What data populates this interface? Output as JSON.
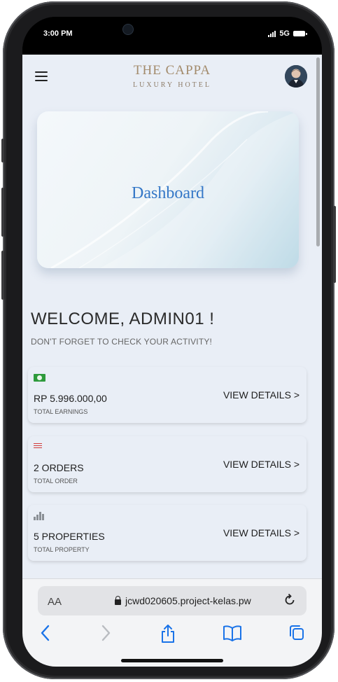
{
  "status_bar": {
    "time": "3:00 PM",
    "network": "5G"
  },
  "header": {
    "brand_title": "THE CAPPA",
    "brand_subtitle": "LUXURY HOTEL"
  },
  "hero": {
    "title": "Dashboard"
  },
  "welcome": {
    "heading": "WELCOME, ADMIN01 !",
    "reminder": "DON'T FORGET TO CHECK YOUR ACTIVITY!"
  },
  "cards": [
    {
      "icon": "money-icon",
      "value": "RP 5.996.000,00",
      "label": "TOTAL EARNINGS",
      "action": "VIEW DETAILS >"
    },
    {
      "icon": "list-icon",
      "value": "2 ORDERS",
      "label": "TOTAL ORDER",
      "action": "VIEW DETAILS >"
    },
    {
      "icon": "building-icon",
      "value": "5 PROPERTIES",
      "label": "TOTAL PROPERTY",
      "action": "VIEW DETAILS >"
    }
  ],
  "browser": {
    "text_size_label": "AA",
    "url": "jcwd020605.project-kelas.pw"
  },
  "colors": {
    "brand_gold": "#a38b6c",
    "accent_blue": "#3477c7",
    "ios_blue": "#1a73e8",
    "page_bg": "#e9eef6"
  }
}
